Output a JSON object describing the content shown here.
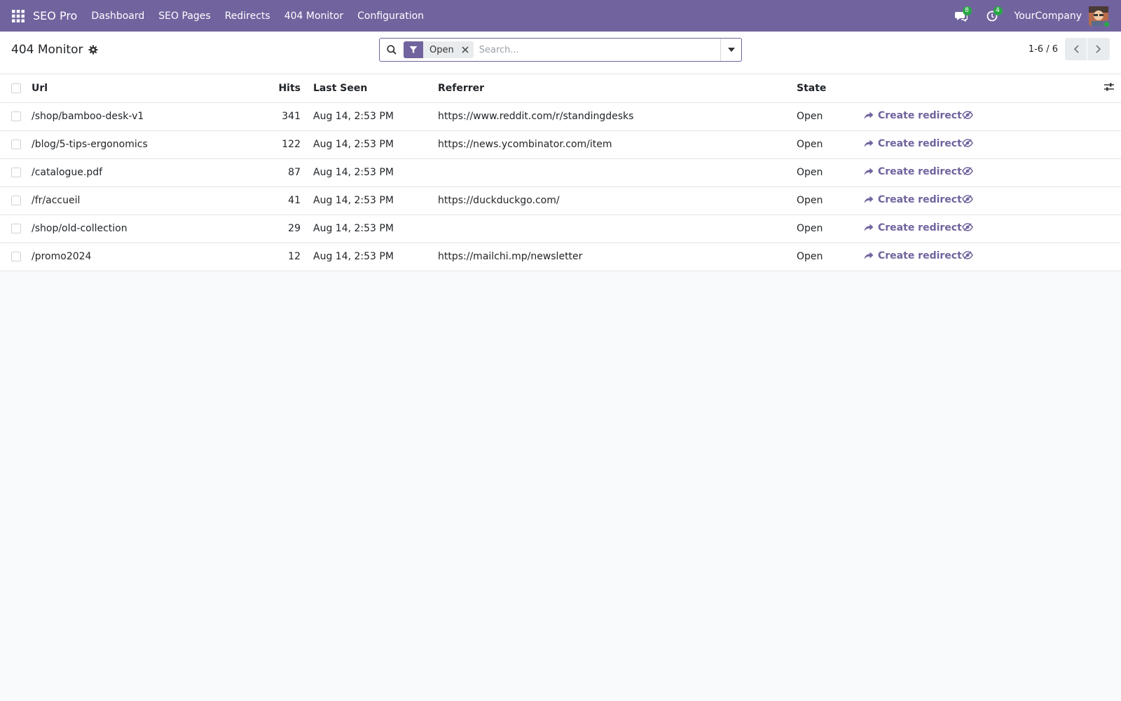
{
  "navbar": {
    "brand": "SEO Pro",
    "menu": [
      "Dashboard",
      "SEO Pages",
      "Redirects",
      "404 Monitor",
      "Configuration"
    ],
    "messages_count": "8",
    "activities_count": "4",
    "company": "YourCompany",
    "icons": [
      "apps-grid-icon",
      "chat-icon",
      "clock-icon",
      "user-avatar"
    ]
  },
  "control": {
    "title": "404 Monitor",
    "facet_label": "Open",
    "search_placeholder": "Search...",
    "pager": "1-6 / 6"
  },
  "table": {
    "columns": [
      "Url",
      "Hits",
      "Last Seen",
      "Referrer",
      "State"
    ],
    "action_label": "Create redirect",
    "rows": [
      {
        "url": "/shop/bamboo-desk-v1",
        "hits": "341",
        "last_seen": "Aug 14, 2:53 PM",
        "referrer": "https://www.reddit.com/r/standingdesks",
        "state": "Open"
      },
      {
        "url": "/blog/5-tips-ergonomics",
        "hits": "122",
        "last_seen": "Aug 14, 2:53 PM",
        "referrer": "https://news.ycombinator.com/item",
        "state": "Open"
      },
      {
        "url": "/catalogue.pdf",
        "hits": "87",
        "last_seen": "Aug 14, 2:53 PM",
        "referrer": "",
        "state": "Open"
      },
      {
        "url": "/fr/accueil",
        "hits": "41",
        "last_seen": "Aug 14, 2:53 PM",
        "referrer": "https://duckduckgo.com/",
        "state": "Open"
      },
      {
        "url": "/shop/old-collection",
        "hits": "29",
        "last_seen": "Aug 14, 2:53 PM",
        "referrer": "",
        "state": "Open"
      },
      {
        "url": "/promo2024",
        "hits": "12",
        "last_seen": "Aug 14, 2:53 PM",
        "referrer": "https://mailchi.mp/newsletter",
        "state": "Open"
      }
    ]
  },
  "colors": {
    "primary": "#71639e",
    "badge": "#28a745"
  }
}
